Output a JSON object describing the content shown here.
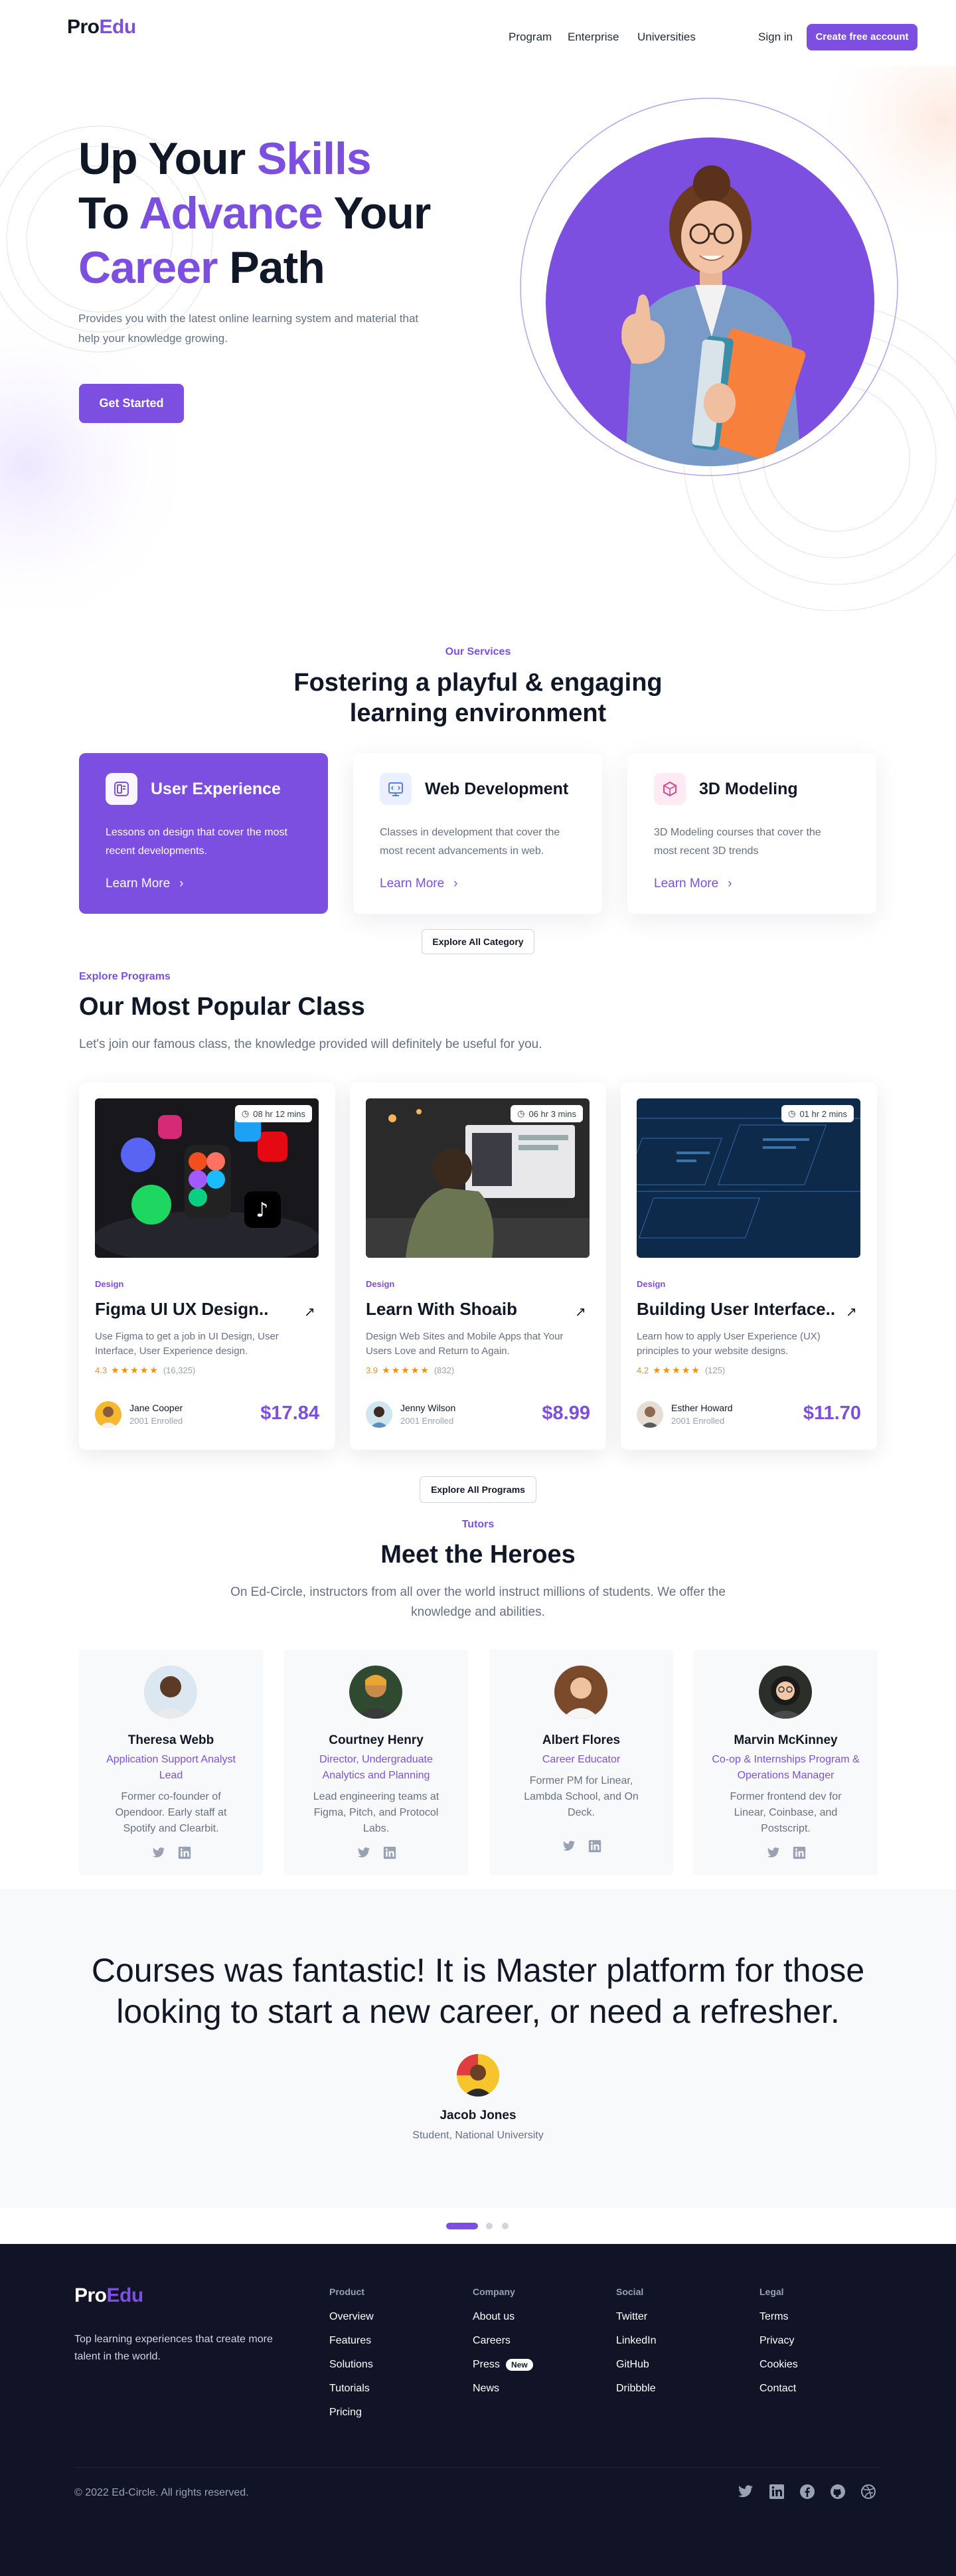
{
  "nav": {
    "logo_a": "Pro",
    "logo_b": "Edu",
    "links": [
      "Program",
      "Enterprise",
      "Universities"
    ],
    "sign_in": "Sign in",
    "cta": "Create free account"
  },
  "hero": {
    "line1a": "Up Your ",
    "line1b": "Skills",
    "line2a": "To ",
    "line2b": "Advance",
    "line2c": " Your",
    "line3a": "Career",
    "line3b": " Path",
    "sub": "Provides you with the latest online learning system and material that help your knowledge growing.",
    "cta": "Get Started"
  },
  "services": {
    "eyebrow": "Our Services",
    "title": "Fostering a playful & engaging learning environment",
    "cards": [
      {
        "title": "User Experience",
        "desc": "Lessons on design that cover the most recent developments.",
        "link": "Learn More"
      },
      {
        "title": "Web Development",
        "desc": "Classes in development that cover the most recent advancements in web.",
        "link": "Learn More"
      },
      {
        "title": "3D Modeling",
        "desc": "3D Modeling courses that cover the most recent 3D trends",
        "link": "Learn More"
      }
    ],
    "explore": "Explore All Category"
  },
  "programs": {
    "eyebrow": "Explore Programs",
    "title": "Our Most Popular Class",
    "sub": "Let's join our famous class, the knowledge provided will definitely be useful for you.",
    "cards": [
      {
        "duration": "08 hr 12 mins",
        "category": "Design",
        "title": "Figma UI UX Design..",
        "desc": "Use Figma to get a job in UI Design, User Interface, User Experience design.",
        "rating": "4.3",
        "stars": "★★★★★",
        "count": "(16,325)",
        "instructor": "Jane Cooper",
        "enrolled": "2001 Enrolled",
        "price": "$17.84"
      },
      {
        "duration": "06 hr 3 mins",
        "category": "Design",
        "title": "Learn With Shoaib",
        "desc": "Design Web Sites and Mobile Apps that Your Users Love and Return to Again.",
        "rating": "3.9",
        "stars": "★★★★★",
        "count": "(832)",
        "instructor": "Jenny Wilson",
        "enrolled": "2001 Enrolled",
        "price": "$8.99"
      },
      {
        "duration": "01 hr 2 mins",
        "category": "Design",
        "title": "Building User Interface..",
        "desc": "Learn how to apply User Experience (UX) principles to your website designs.",
        "rating": "4.2",
        "stars": "★★★★★",
        "count": "(125)",
        "instructor": "Esther Howard",
        "enrolled": "2001 Enrolled",
        "price": "$11.70"
      }
    ],
    "explore": "Explore All Programs"
  },
  "tutors": {
    "eyebrow": "Tutors",
    "title": "Meet the Heroes",
    "sub": "On Ed-Circle, instructors from all over the world instruct millions of students. We offer the knowledge and abilities.",
    "cards": [
      {
        "name": "Theresa Webb",
        "role": "Application Support Analyst Lead",
        "bio": "Former co-founder of Opendoor. Early staff at Spotify and Clearbit."
      },
      {
        "name": "Courtney Henry",
        "role": "Director, Undergraduate Analytics and Planning",
        "bio": "Lead engineering teams at Figma, Pitch, and Protocol Labs."
      },
      {
        "name": "Albert Flores",
        "role": "Career Educator",
        "bio": "Former PM for Linear, Lambda School, and On Deck."
      },
      {
        "name": "Marvin McKinney",
        "role": "Co-op & Internships Program & Operations Manager",
        "bio": "Former frontend dev for Linear, Coinbase, and Postscript."
      }
    ]
  },
  "testimonial": {
    "quote": "Courses was fantastic! It is Master platform for those looking to start a new career, or need a refresher.",
    "name": "Jacob Jones",
    "role": "Student, National University"
  },
  "footer": {
    "logo_a": "Pro",
    "logo_b": "Edu",
    "desc": "Top learning experiences that create more talent in the world.",
    "columns": [
      {
        "head": "Product",
        "links": [
          "Overview",
          "Features",
          "Solutions",
          "Tutorials",
          "Pricing"
        ]
      },
      {
        "head": "Company",
        "links": [
          "About us",
          "Careers",
          "Press",
          "News"
        ]
      },
      {
        "head": "Social",
        "links": [
          "Twitter",
          "LinkedIn",
          "GitHub",
          "Dribbble"
        ]
      },
      {
        "head": "Legal",
        "links": [
          "Terms",
          "Privacy",
          "Cookies",
          "Contact"
        ]
      }
    ],
    "new_badge": "New",
    "copyright": "© 2022 Ed-Circle. All rights reserved."
  },
  "colors": {
    "accent": "#7d4fe0",
    "dark": "#101426",
    "text": "#101828",
    "muted": "#667085"
  }
}
